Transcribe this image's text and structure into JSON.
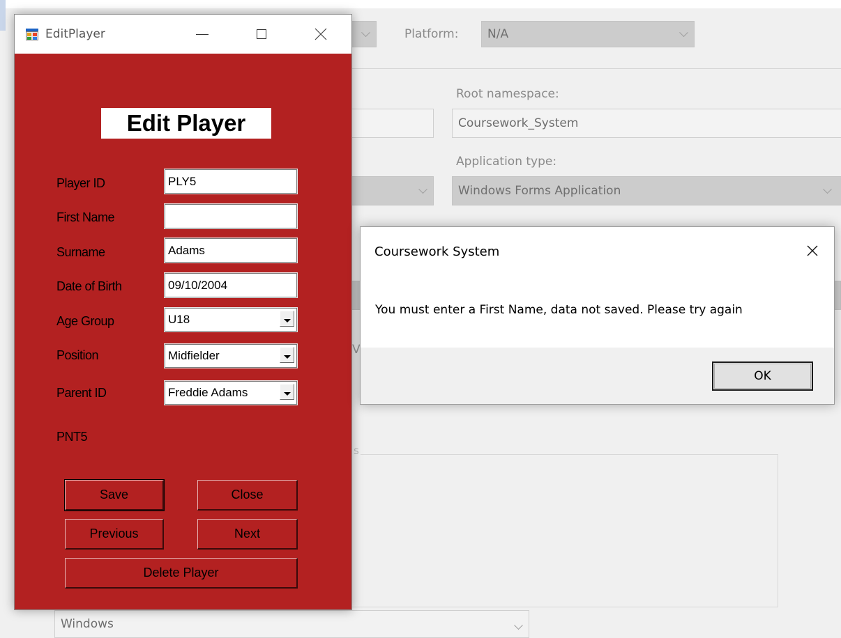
{
  "background": {
    "platform_label": "Platform:",
    "platform_value": "N/A",
    "root_namespace_label": "Root namespace:",
    "root_namespace_value": "Coursework_System",
    "application_type_label": "Application type:",
    "application_type_value": "Windows Forms Application",
    "partial_letter": "V",
    "partial_group_char": "s",
    "target_os_value": "Windows"
  },
  "edit_window": {
    "title": "EditPlayer",
    "heading": "Edit Player",
    "fields": {
      "player_id_label": "Player ID",
      "player_id_value": "PLY5",
      "first_name_label": "First Name",
      "first_name_value": "",
      "surname_label": "Surname",
      "surname_value": "Adams",
      "dob_label": "Date of Birth",
      "dob_value": "09/10/2004",
      "age_group_label": "Age Group",
      "age_group_value": "U18",
      "position_label": "Position",
      "position_value": "Midfielder",
      "parent_id_label": "Parent ID",
      "parent_id_value": "Freddie Adams"
    },
    "parent_code": "PNT5",
    "buttons": {
      "save": "Save",
      "close": "Close",
      "previous": "Previous",
      "next": "Next",
      "delete": "Delete Player"
    }
  },
  "message_box": {
    "title": "Coursework System",
    "message": "You must enter a First Name, data not saved. Please try again",
    "ok": "OK"
  },
  "colors": {
    "form_background": "#b32121",
    "window_chrome": "#ffffff",
    "dialog_footer": "#f0f0f0"
  }
}
